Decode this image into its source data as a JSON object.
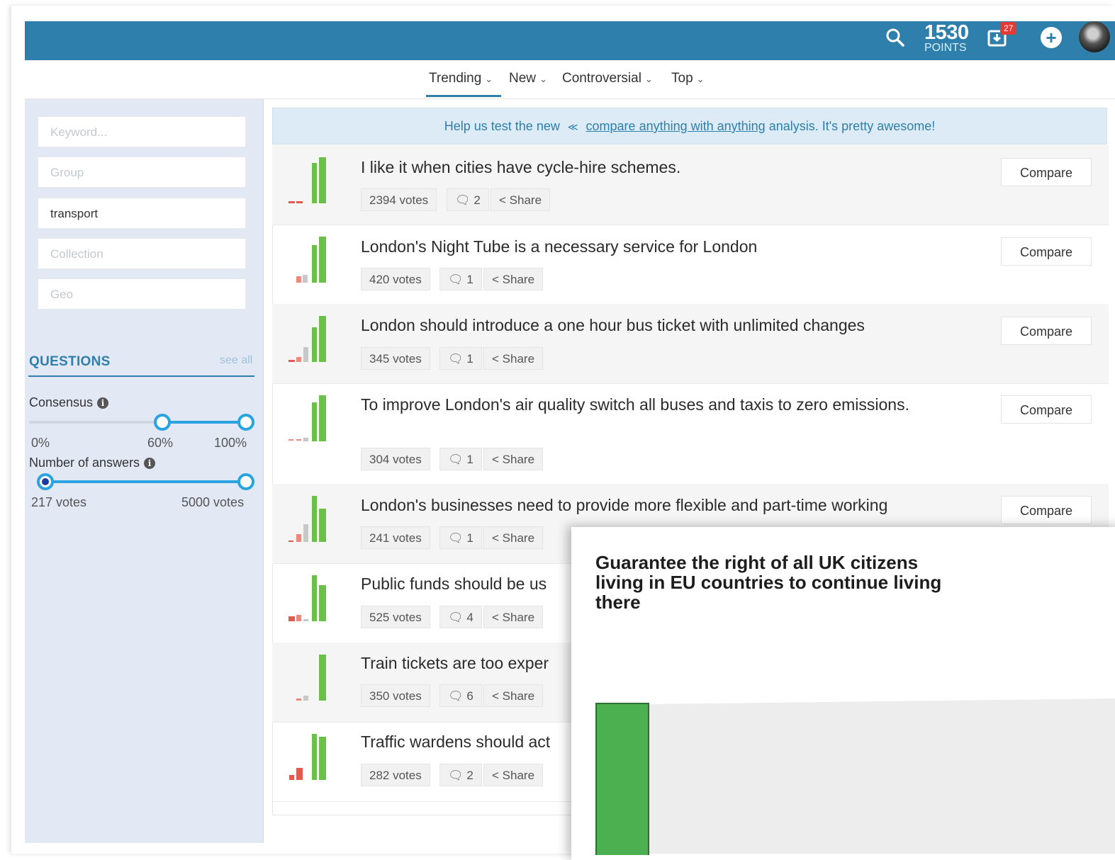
{
  "header": {
    "points_value": "1530",
    "points_label": "POINTS",
    "notifications_count": "27",
    "icons": [
      "search-icon",
      "inbox-icon",
      "plus-icon",
      "avatar"
    ]
  },
  "tabs": [
    {
      "label": "Trending",
      "active": true
    },
    {
      "label": "New"
    },
    {
      "label": "Controversial"
    },
    {
      "label": "Top"
    }
  ],
  "filters": {
    "keyword_placeholder": "Keyword...",
    "group_placeholder": "Group",
    "tag_value": "transport",
    "collection_placeholder": "Collection",
    "geo_placeholder": "Geo"
  },
  "questions_panel": {
    "title": "QUESTIONS",
    "see_all": "see all",
    "consensus_label": "Consensus",
    "consensus_ticks": [
      "0%",
      "60%",
      "100%"
    ],
    "consensus_range": [
      60,
      100
    ],
    "answers_label": "Number of answers",
    "answers_ticks": [
      "217 votes",
      "5000 votes"
    ],
    "answers_range": [
      217,
      5000
    ]
  },
  "banner": {
    "prefix": "Help us test the new",
    "link": "compare anything with anything",
    "suffix": "analysis. It's pretty awesome!"
  },
  "share_label": "Share",
  "compare_label": "Compare",
  "questions": [
    {
      "text": "I like it when cities have cycle-hire schemes.",
      "votes": "2394 votes",
      "comments": "2"
    },
    {
      "text": "London's Night Tube is a necessary service for London",
      "votes": "420 votes",
      "comments": "1"
    },
    {
      "text": "London should introduce a one hour bus ticket with unlimited changes",
      "votes": "345 votes",
      "comments": "1"
    },
    {
      "text": "To improve London's air quality switch all buses and taxis to zero emissions.",
      "votes": "304 votes",
      "comments": "1"
    },
    {
      "text": "London's businesses need to provide more flexible and part-time working",
      "votes": "241 votes",
      "comments": "1"
    },
    {
      "text": "Public funds should be us",
      "votes": "525 votes",
      "comments": "4"
    },
    {
      "text": "Train tickets are too exper",
      "votes": "350 votes",
      "comments": "6"
    },
    {
      "text": "Traffic wardens should act",
      "votes": "282 votes",
      "comments": "2"
    }
  ],
  "popup": {
    "title": "Guarantee the right of all UK citizens living in EU countries to continue living there"
  },
  "colors": {
    "brand": "#2e7fab",
    "agree": "#6cbf4a",
    "disagree": "#e05a4f",
    "neutral": "#c8c8c8"
  }
}
